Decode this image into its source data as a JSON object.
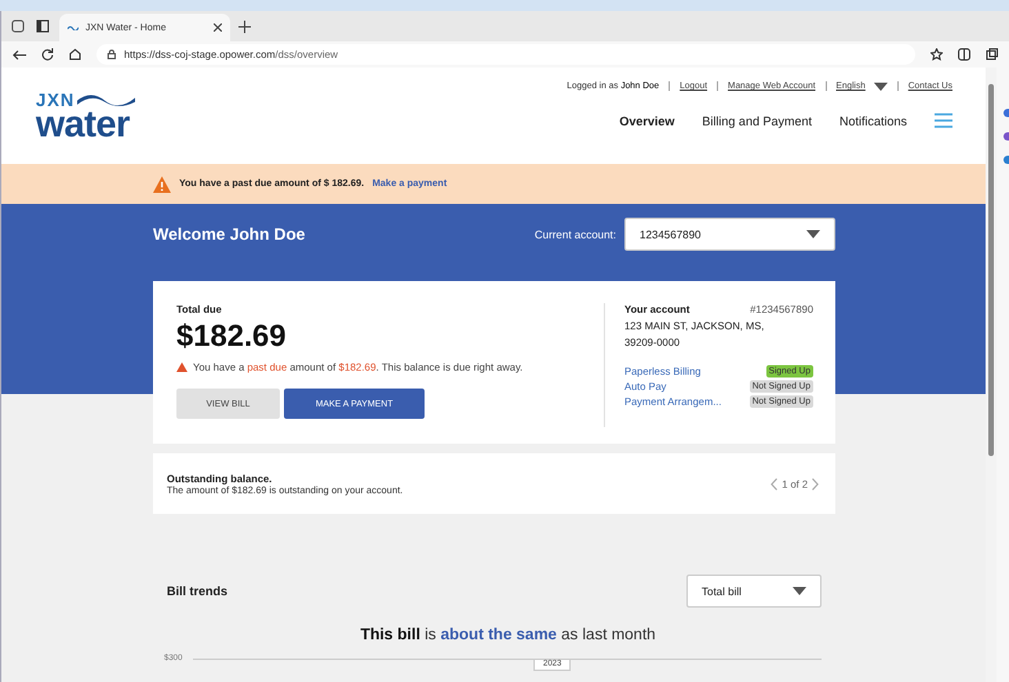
{
  "browser": {
    "tab_title": "JXN Water - Home",
    "url_host": "https://dss-coj-stage.opower.com",
    "url_path": "/dss/overview"
  },
  "header": {
    "logo_top": "JXN",
    "logo_bottom": "water",
    "utility_links": [
      {
        "kind": "text",
        "label": "Logged in as ",
        "name": "John Doe"
      },
      {
        "kind": "link",
        "label": "Logout"
      },
      {
        "kind": "link",
        "label": "Manage Web Account"
      },
      {
        "kind": "dropdown",
        "label": "English"
      },
      {
        "kind": "link",
        "label": "Contact Us"
      }
    ],
    "nav": [
      {
        "label": "Overview",
        "selected": true
      },
      {
        "label": "Billing and Payment",
        "selected": false
      },
      {
        "label": "Notifications",
        "selected": false
      }
    ]
  },
  "alert_banner": {
    "text": "You have a past due amount of $ 182.69.",
    "link": "Make a payment"
  },
  "welcome": {
    "title": "Welcome John Doe",
    "account_label": "Current account:",
    "account_value": "1234567890"
  },
  "summary": {
    "total_label": "Total due",
    "amount": "$182.69",
    "warning": [
      {
        "kind": "plain",
        "text": "You have a "
      },
      {
        "kind": "alert",
        "text": "past due"
      },
      {
        "kind": "plain",
        "text": " amount of "
      },
      {
        "kind": "alert",
        "text": "$182.69"
      },
      {
        "kind": "plain",
        "text": ". This balance is due right away."
      }
    ],
    "buttons": [
      {
        "label": "VIEW BILL",
        "kind": "secondary"
      },
      {
        "label": "MAKE A PAYMENT",
        "kind": "primary"
      }
    ],
    "account": {
      "title": "Your account",
      "number": "#1234567890",
      "street": "123 MAIN ST,",
      "city": "JACKSON, MS,",
      "zip": "39209-0000",
      "programs": [
        {
          "name": "Paperless Billing",
          "status": "Signed Up",
          "signed_up": true
        },
        {
          "name": "Auto Pay",
          "status": "Not Signed Up",
          "signed_up": false
        },
        {
          "name": "Payment Arrangem...",
          "status": "Not Signed Up",
          "signed_up": false
        }
      ]
    }
  },
  "outstanding": {
    "title": "Outstanding balance.",
    "text": "The amount of $182.69 is outstanding on your account.",
    "pager": "1 of 2"
  },
  "bill_trends": {
    "title": "Bill trends",
    "select": "Total bill",
    "headline": [
      {
        "kind": "bold",
        "text": "This bill"
      },
      {
        "kind": "plain",
        "text": " is "
      },
      {
        "kind": "highlight",
        "text": "about the same"
      },
      {
        "kind": "plain",
        "text": " as last month"
      }
    ],
    "axis_label": "$300",
    "year_label": "2023"
  }
}
